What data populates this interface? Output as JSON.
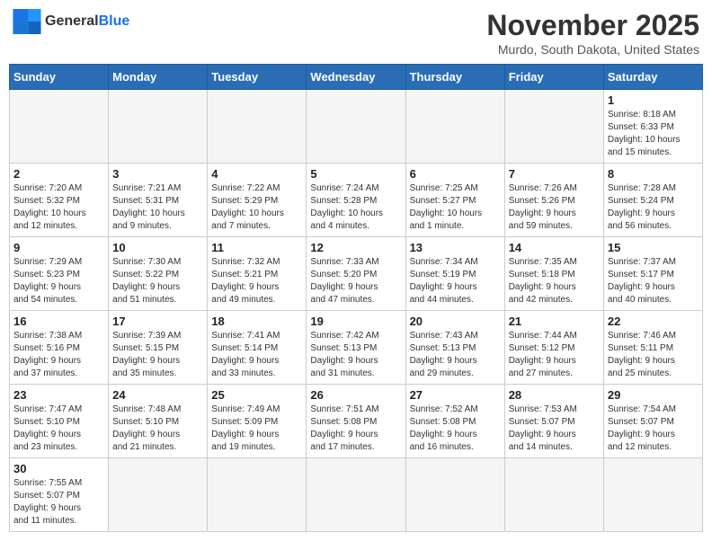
{
  "header": {
    "logo_line1": "General",
    "logo_line2": "Blue",
    "month_title": "November 2025",
    "location": "Murdo, South Dakota, United States"
  },
  "days_of_week": [
    "Sunday",
    "Monday",
    "Tuesday",
    "Wednesday",
    "Thursday",
    "Friday",
    "Saturday"
  ],
  "weeks": [
    [
      {
        "day": "",
        "info": ""
      },
      {
        "day": "",
        "info": ""
      },
      {
        "day": "",
        "info": ""
      },
      {
        "day": "",
        "info": ""
      },
      {
        "day": "",
        "info": ""
      },
      {
        "day": "",
        "info": ""
      },
      {
        "day": "1",
        "info": "Sunrise: 8:18 AM\nSunset: 6:33 PM\nDaylight: 10 hours\nand 15 minutes."
      }
    ],
    [
      {
        "day": "2",
        "info": "Sunrise: 7:20 AM\nSunset: 5:32 PM\nDaylight: 10 hours\nand 12 minutes."
      },
      {
        "day": "3",
        "info": "Sunrise: 7:21 AM\nSunset: 5:31 PM\nDaylight: 10 hours\nand 9 minutes."
      },
      {
        "day": "4",
        "info": "Sunrise: 7:22 AM\nSunset: 5:29 PM\nDaylight: 10 hours\nand 7 minutes."
      },
      {
        "day": "5",
        "info": "Sunrise: 7:24 AM\nSunset: 5:28 PM\nDaylight: 10 hours\nand 4 minutes."
      },
      {
        "day": "6",
        "info": "Sunrise: 7:25 AM\nSunset: 5:27 PM\nDaylight: 10 hours\nand 1 minute."
      },
      {
        "day": "7",
        "info": "Sunrise: 7:26 AM\nSunset: 5:26 PM\nDaylight: 9 hours\nand 59 minutes."
      },
      {
        "day": "8",
        "info": "Sunrise: 7:28 AM\nSunset: 5:24 PM\nDaylight: 9 hours\nand 56 minutes."
      }
    ],
    [
      {
        "day": "9",
        "info": "Sunrise: 7:29 AM\nSunset: 5:23 PM\nDaylight: 9 hours\nand 54 minutes."
      },
      {
        "day": "10",
        "info": "Sunrise: 7:30 AM\nSunset: 5:22 PM\nDaylight: 9 hours\nand 51 minutes."
      },
      {
        "day": "11",
        "info": "Sunrise: 7:32 AM\nSunset: 5:21 PM\nDaylight: 9 hours\nand 49 minutes."
      },
      {
        "day": "12",
        "info": "Sunrise: 7:33 AM\nSunset: 5:20 PM\nDaylight: 9 hours\nand 47 minutes."
      },
      {
        "day": "13",
        "info": "Sunrise: 7:34 AM\nSunset: 5:19 PM\nDaylight: 9 hours\nand 44 minutes."
      },
      {
        "day": "14",
        "info": "Sunrise: 7:35 AM\nSunset: 5:18 PM\nDaylight: 9 hours\nand 42 minutes."
      },
      {
        "day": "15",
        "info": "Sunrise: 7:37 AM\nSunset: 5:17 PM\nDaylight: 9 hours\nand 40 minutes."
      }
    ],
    [
      {
        "day": "16",
        "info": "Sunrise: 7:38 AM\nSunset: 5:16 PM\nDaylight: 9 hours\nand 37 minutes."
      },
      {
        "day": "17",
        "info": "Sunrise: 7:39 AM\nSunset: 5:15 PM\nDaylight: 9 hours\nand 35 minutes."
      },
      {
        "day": "18",
        "info": "Sunrise: 7:41 AM\nSunset: 5:14 PM\nDaylight: 9 hours\nand 33 minutes."
      },
      {
        "day": "19",
        "info": "Sunrise: 7:42 AM\nSunset: 5:13 PM\nDaylight: 9 hours\nand 31 minutes."
      },
      {
        "day": "20",
        "info": "Sunrise: 7:43 AM\nSunset: 5:13 PM\nDaylight: 9 hours\nand 29 minutes."
      },
      {
        "day": "21",
        "info": "Sunrise: 7:44 AM\nSunset: 5:12 PM\nDaylight: 9 hours\nand 27 minutes."
      },
      {
        "day": "22",
        "info": "Sunrise: 7:46 AM\nSunset: 5:11 PM\nDaylight: 9 hours\nand 25 minutes."
      }
    ],
    [
      {
        "day": "23",
        "info": "Sunrise: 7:47 AM\nSunset: 5:10 PM\nDaylight: 9 hours\nand 23 minutes."
      },
      {
        "day": "24",
        "info": "Sunrise: 7:48 AM\nSunset: 5:10 PM\nDaylight: 9 hours\nand 21 minutes."
      },
      {
        "day": "25",
        "info": "Sunrise: 7:49 AM\nSunset: 5:09 PM\nDaylight: 9 hours\nand 19 minutes."
      },
      {
        "day": "26",
        "info": "Sunrise: 7:51 AM\nSunset: 5:08 PM\nDaylight: 9 hours\nand 17 minutes."
      },
      {
        "day": "27",
        "info": "Sunrise: 7:52 AM\nSunset: 5:08 PM\nDaylight: 9 hours\nand 16 minutes."
      },
      {
        "day": "28",
        "info": "Sunrise: 7:53 AM\nSunset: 5:07 PM\nDaylight: 9 hours\nand 14 minutes."
      },
      {
        "day": "29",
        "info": "Sunrise: 7:54 AM\nSunset: 5:07 PM\nDaylight: 9 hours\nand 12 minutes."
      }
    ],
    [
      {
        "day": "30",
        "info": "Sunrise: 7:55 AM\nSunset: 5:07 PM\nDaylight: 9 hours\nand 11 minutes."
      },
      {
        "day": "",
        "info": ""
      },
      {
        "day": "",
        "info": ""
      },
      {
        "day": "",
        "info": ""
      },
      {
        "day": "",
        "info": ""
      },
      {
        "day": "",
        "info": ""
      },
      {
        "day": "",
        "info": ""
      }
    ]
  ]
}
